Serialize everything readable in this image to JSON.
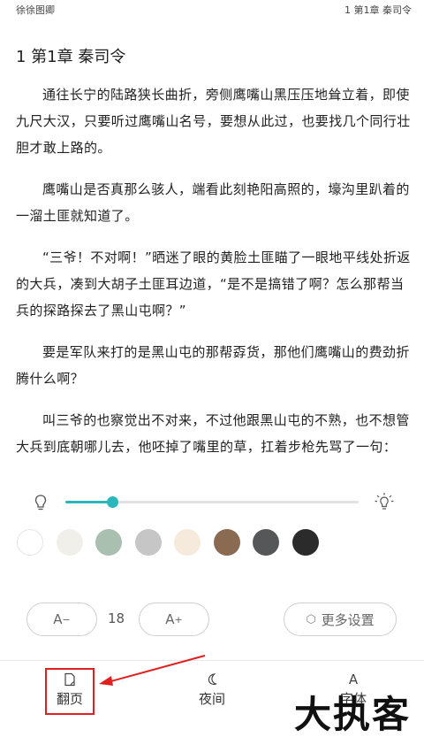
{
  "status_bar": {
    "left": "徐徐图卿",
    "right": "1 第1章 秦司令"
  },
  "chapter_title": "1 第1章 秦司令",
  "paragraphs": [
    "通往长宁的陆路狭长曲折，旁侧鹰嘴山黑压压地耸立着，即使九尺大汉，只要听过鹰嘴山名号，要想从此过，也要找几个同行壮胆才敢上路的。",
    "鹰嘴山是否真那么骇人，端看此刻艳阳高照的，壕沟里趴着的一溜土匪就知道了。",
    "“三爷！不对啊！”晒迷了眼的黄脸土匪瞄了一眼地平线处折返的大兵，凑到大胡子土匪耳边道，“是不是搞错了啊？怎么那帮当兵的探路探去了黑山屯啊？”",
    "要是军队来打的是黑山屯的那帮孬货，那他们鹰嘴山的费劲折腾什么啊？",
    "叫三爷的也察觉出不对来，不过他跟黑山屯的不熟，也不想管大兵到底朝哪儿去，他呸掉了嘴里的草，扛着步枪先骂了一句："
  ],
  "brightness": {
    "level": 0.16,
    "accent_color": "#2ab7bb",
    "dim_icon": "bulb-dim-icon",
    "bright_icon": "bulb-bright-icon"
  },
  "background_swatches": [
    "#ffffff",
    "#f1efea",
    "#a9bfb0",
    "#c6c6c6",
    "#f5eadb",
    "#8a6b52",
    "#555759",
    "#2b2b2b"
  ],
  "font_controls": {
    "decrease_label": "A",
    "decrease_sign": "−",
    "increase_label": "A",
    "increase_sign": "+",
    "size_value": "18",
    "more_settings_label": "更多设置",
    "more_settings_icon": "hexagon-settings-icon"
  },
  "bottom_nav": {
    "items": [
      {
        "label": "翻页",
        "icon": "page-flip-icon"
      },
      {
        "label": "夜间",
        "icon": "moon-icon"
      },
      {
        "label": "字体",
        "icon": "font-icon"
      }
    ]
  },
  "annotation_color": "#e02020",
  "watermark_text": "大执客"
}
